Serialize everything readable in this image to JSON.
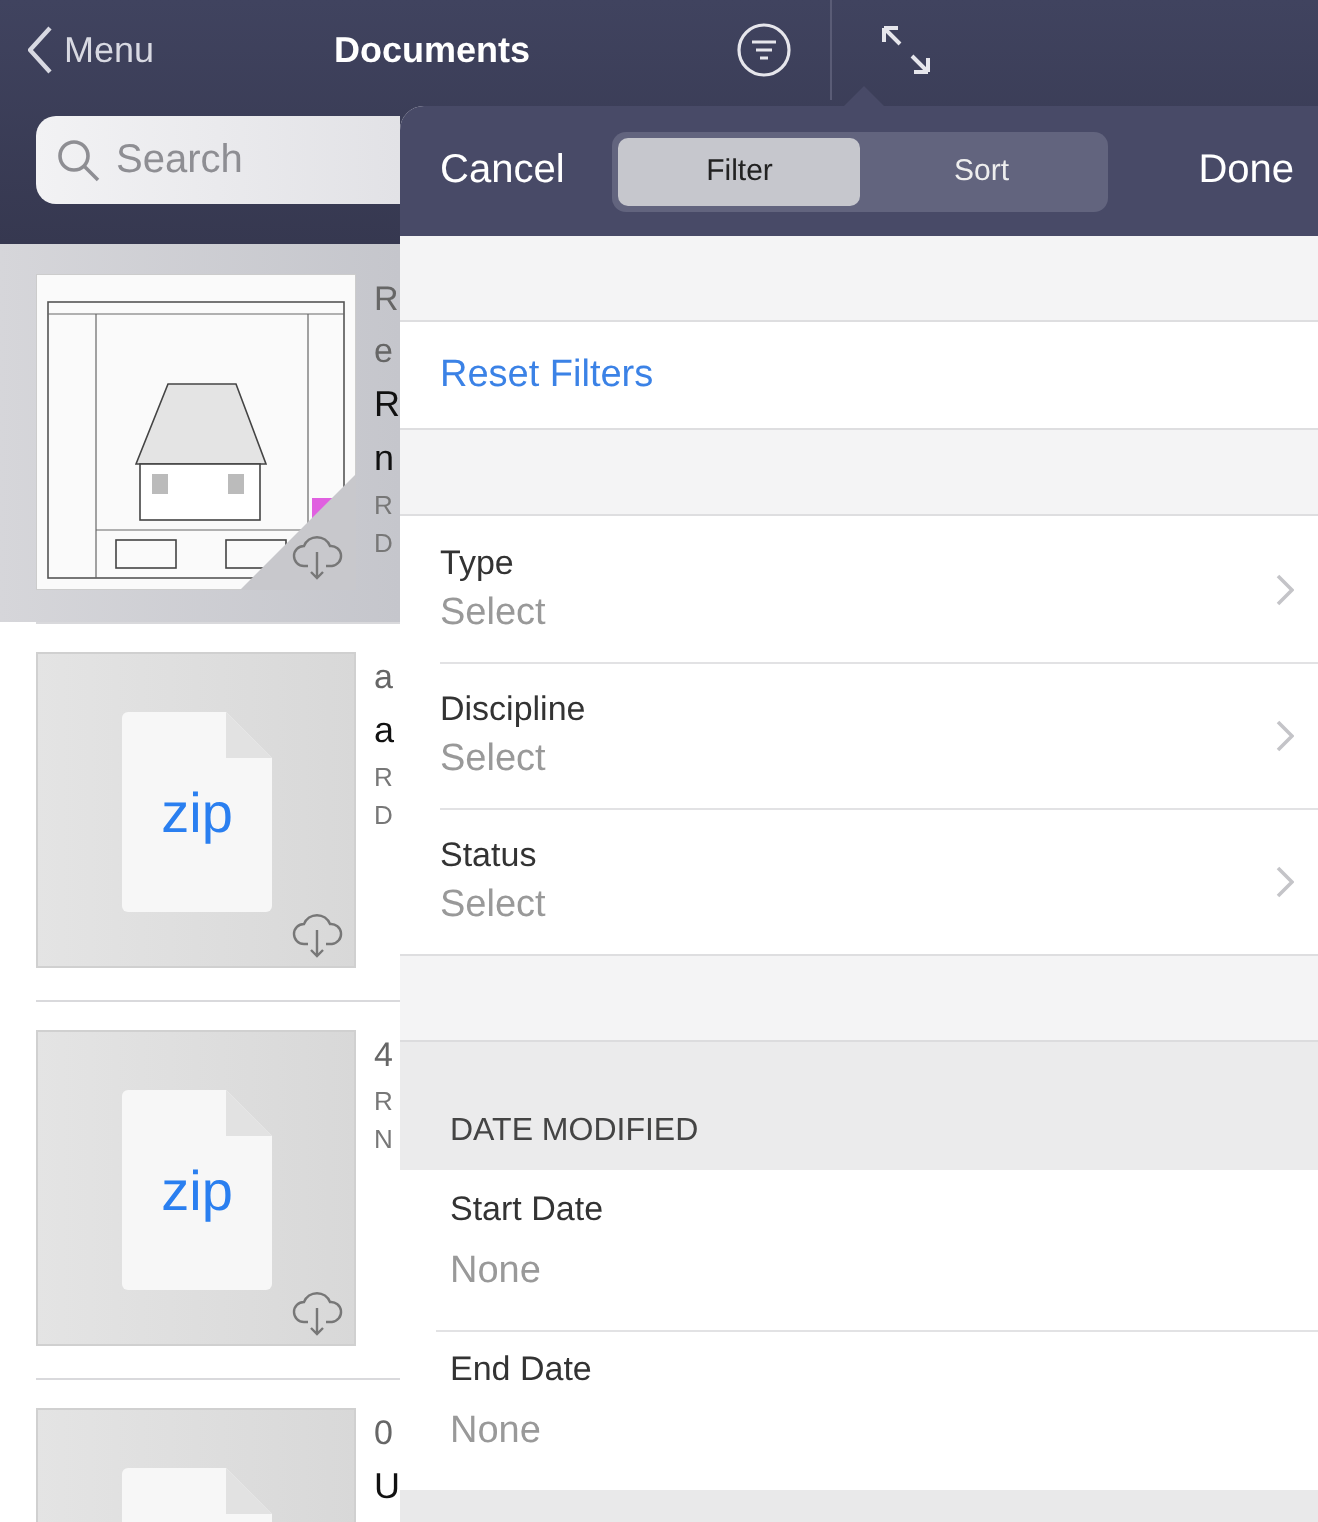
{
  "nav": {
    "back": "Menu",
    "title": "Documents"
  },
  "search": {
    "placeholder": "Search"
  },
  "documents": [
    {
      "selected": true,
      "thumb": {
        "kind": "picture",
        "download": true
      },
      "lines": [
        {
          "kind": "top",
          "text": "R"
        },
        {
          "kind": "top",
          "text": "e"
        },
        {
          "kind": "name",
          "text": "R"
        },
        {
          "kind": "name",
          "text": "n"
        },
        {
          "kind": "meta",
          "text": "R"
        },
        {
          "kind": "meta",
          "text": "D"
        }
      ]
    },
    {
      "selected": false,
      "thumb": {
        "kind": "file",
        "label": "zip",
        "download": true
      },
      "lines": [
        {
          "kind": "top",
          "text": "a"
        },
        {
          "kind": "name",
          "text": "a"
        },
        {
          "kind": "meta",
          "text": "R"
        },
        {
          "kind": "meta",
          "text": "D"
        }
      ]
    },
    {
      "selected": false,
      "thumb": {
        "kind": "file",
        "label": "zip",
        "download": true
      },
      "lines": [
        {
          "kind": "top",
          "text": "4"
        },
        {
          "kind": "meta",
          "text": "R"
        },
        {
          "kind": "meta",
          "text": "N"
        }
      ]
    },
    {
      "selected": false,
      "thumb": {
        "kind": "file"
      },
      "lines": [
        {
          "kind": "top",
          "text": "0"
        },
        {
          "kind": "name",
          "text": "U"
        }
      ]
    }
  ],
  "popover": {
    "cancel": "Cancel",
    "done": "Done",
    "segments": [
      {
        "label": "Filter",
        "selected": true
      },
      {
        "label": "Sort",
        "selected": false
      }
    ],
    "reset": "Reset Filters",
    "filters": [
      {
        "label": "Type",
        "value": "Select"
      },
      {
        "label": "Discipline",
        "value": "Select"
      },
      {
        "label": "Status",
        "value": "Select"
      }
    ],
    "date_section": {
      "header": "DATE MODIFIED",
      "rows": [
        {
          "label": "Start Date",
          "value": "None"
        },
        {
          "label": "End Date",
          "value": "None"
        }
      ]
    }
  }
}
